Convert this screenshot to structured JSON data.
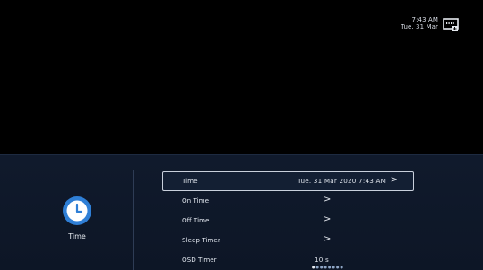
{
  "status": {
    "time": "7:43 AM",
    "date": "Tue. 31 Mar",
    "network_icon": "ethernet-icon"
  },
  "sidebar": {
    "icon": "clock-icon",
    "label": "Time",
    "icon_color": "#2f7fd6"
  },
  "menu": {
    "items": [
      {
        "label": "Time",
        "value": "Tue. 31 Mar 2020 7:43 AM",
        "chevron": ">"
      },
      {
        "label": "On Time",
        "value": "",
        "chevron": ">"
      },
      {
        "label": "Off Time",
        "value": "",
        "chevron": ">"
      },
      {
        "label": "Sleep Timer",
        "value": "",
        "chevron": ">"
      },
      {
        "label": "OSD Timer",
        "value": "10 s",
        "chevron": ""
      }
    ],
    "selected_index": 0
  }
}
